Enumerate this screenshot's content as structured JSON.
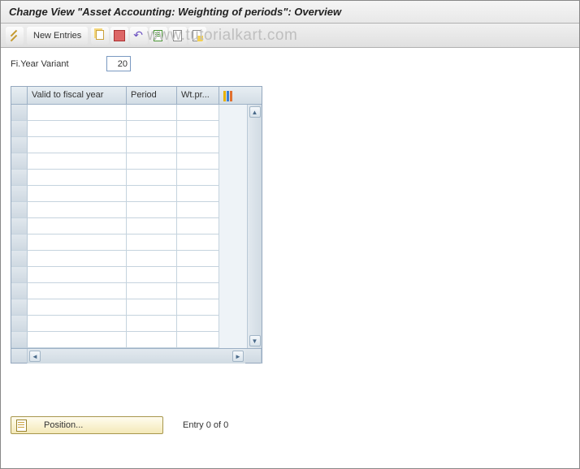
{
  "title": "Change View \"Asset Accounting: Weighting of periods\": Overview",
  "watermark": "www.tutorialkart.com",
  "toolbar": {
    "new_entries_label": "New Entries"
  },
  "field": {
    "label": "Fi.Year Variant",
    "value": "20"
  },
  "grid": {
    "columns": {
      "c1": "Valid to fiscal year",
      "c2": "Period",
      "c3": "Wt.pr..."
    },
    "row_count": 15
  },
  "footer": {
    "position_label": "Position...",
    "entry_status": "Entry 0 of 0"
  }
}
